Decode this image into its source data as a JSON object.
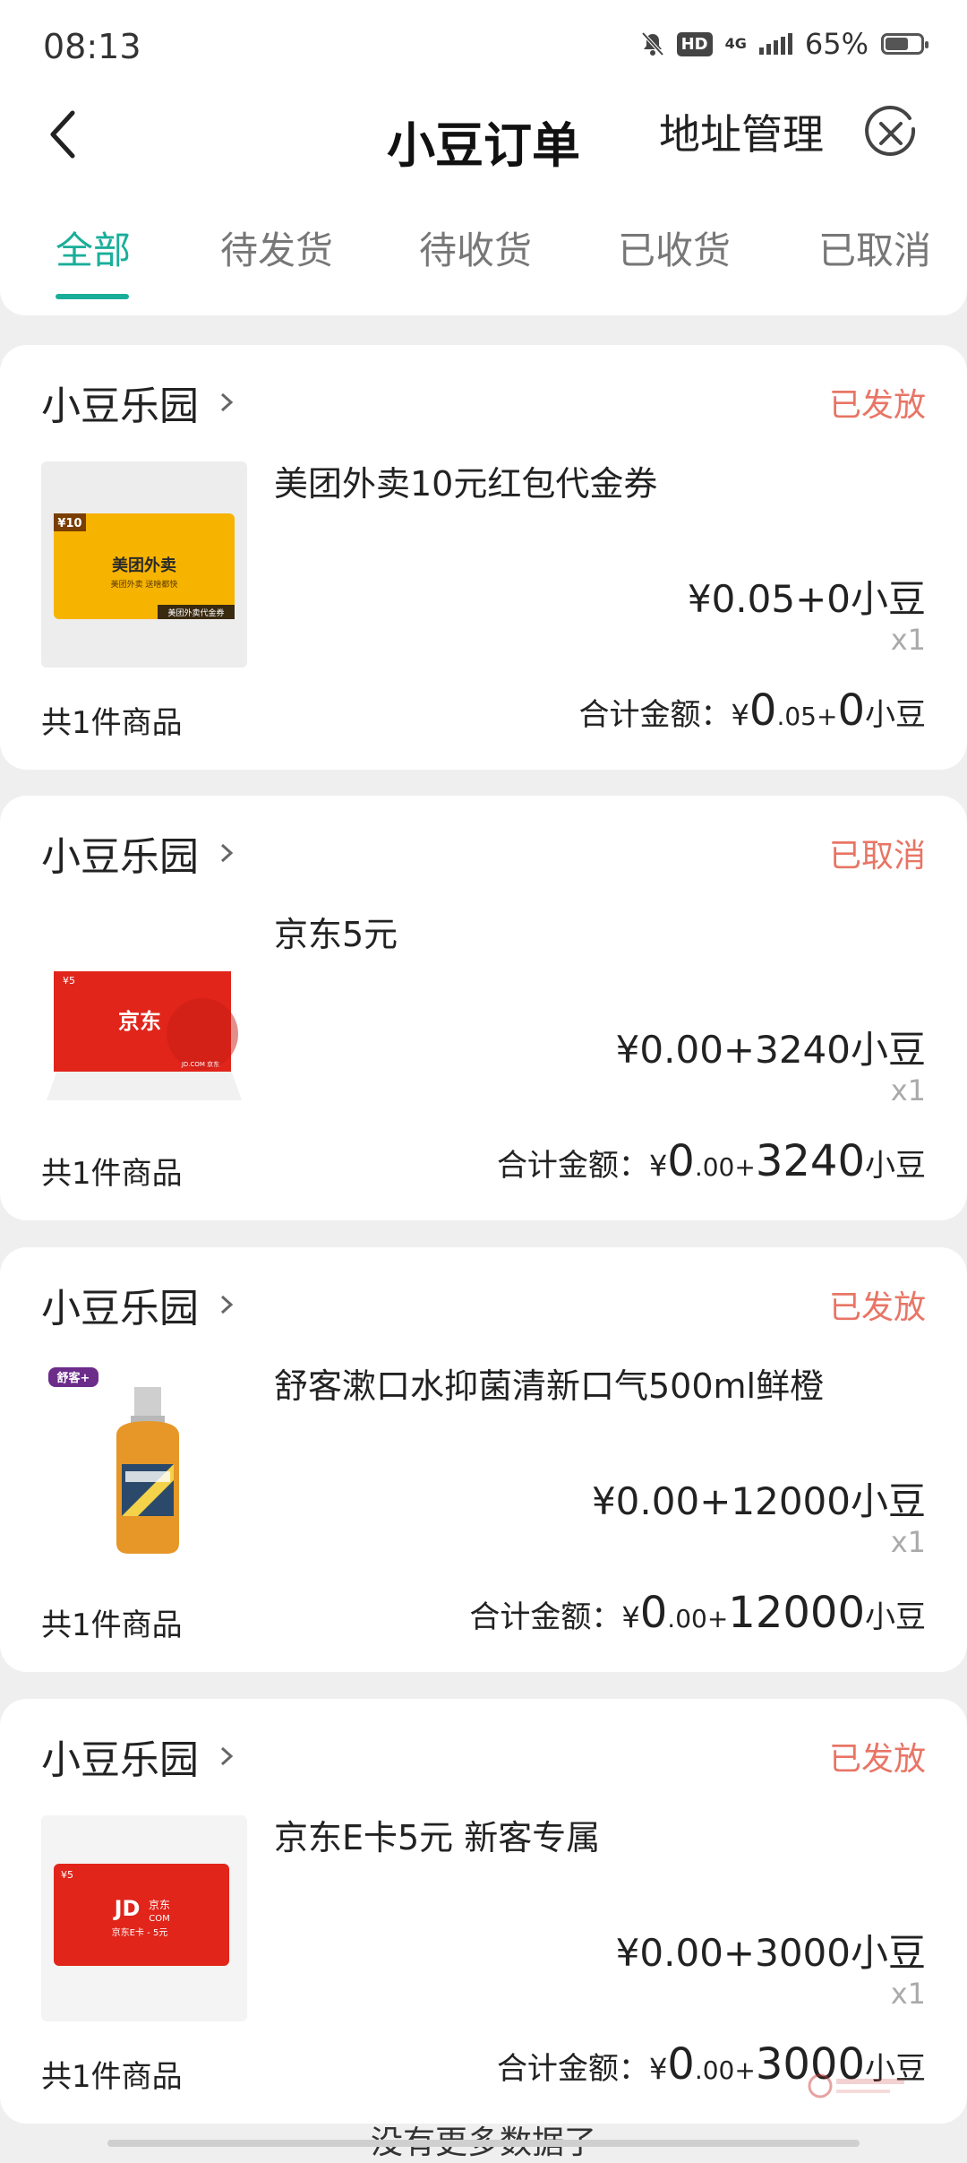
{
  "status_bar": {
    "time": "08:13",
    "hd": "HD",
    "network": "4G",
    "battery": "65%",
    "battery_level": 0.65
  },
  "nav": {
    "title": "小豆订单",
    "address_link": "地址管理"
  },
  "tabs": [
    {
      "label": "全部",
      "active": true
    },
    {
      "label": "待发货"
    },
    {
      "label": "待收货"
    },
    {
      "label": "已收货"
    },
    {
      "label": "已取消"
    }
  ],
  "orders": [
    {
      "store": "小豆乐园",
      "status": "已发放",
      "product": "美团外卖10元红包代金券",
      "price": "¥0.05+0小豆",
      "qty": "x1",
      "count": "共1件商品",
      "total_label": "合计金额：",
      "total_currency": "¥",
      "total_int": "0",
      "total_dec": ".05+",
      "total_beans": "0",
      "total_unit": "小豆",
      "thumb": {
        "badge": "¥10",
        "brand": "美团外卖",
        "slogan": "美团外卖 送啥都快",
        "tag": "美团外卖代金券",
        "accent": "#f5b500"
      }
    },
    {
      "store": "小豆乐园",
      "status": "已取消",
      "product": "京东5元",
      "price": "¥0.00+3240小豆",
      "qty": "x1",
      "count": "共1件商品",
      "total_label": "合计金额：",
      "total_currency": "¥",
      "total_int": "0",
      "total_dec": ".00+",
      "total_beans": "3240",
      "total_unit": "小豆",
      "thumb": {
        "badge": "¥5",
        "brand": "京东",
        "tag": "JD.COM 京东",
        "accent": "#e1251b"
      }
    },
    {
      "store": "小豆乐园",
      "status": "已发放",
      "product": "舒客漱口水抑菌清新口气500ml鲜橙",
      "price": "¥0.00+12000小豆",
      "qty": "x1",
      "count": "共1件商品",
      "total_label": "合计金额：",
      "total_currency": "¥",
      "total_int": "0",
      "total_dec": ".00+",
      "total_beans": "12000",
      "total_unit": "小豆",
      "thumb": {
        "brand": "舒客+",
        "accent": "#e08a1e"
      }
    },
    {
      "store": "小豆乐园",
      "status": "已发放",
      "product": "京东E卡5元 新客专属",
      "price": "¥0.00+3000小豆",
      "qty": "x1",
      "count": "共1件商品",
      "total_label": "合计金额：",
      "total_currency": "¥",
      "total_int": "0",
      "total_dec": ".00+",
      "total_beans": "3000",
      "total_unit": "小豆",
      "thumb": {
        "badge": "¥5",
        "brand": "JD",
        "brand2": "京东",
        "brand3": "COM",
        "tag": "京东E卡 - 5元",
        "accent": "#e1251b"
      }
    }
  ],
  "footer": {
    "text": "没有更多数据了"
  },
  "colors": {
    "accent": "#1aae9a",
    "status": "#e87565"
  }
}
